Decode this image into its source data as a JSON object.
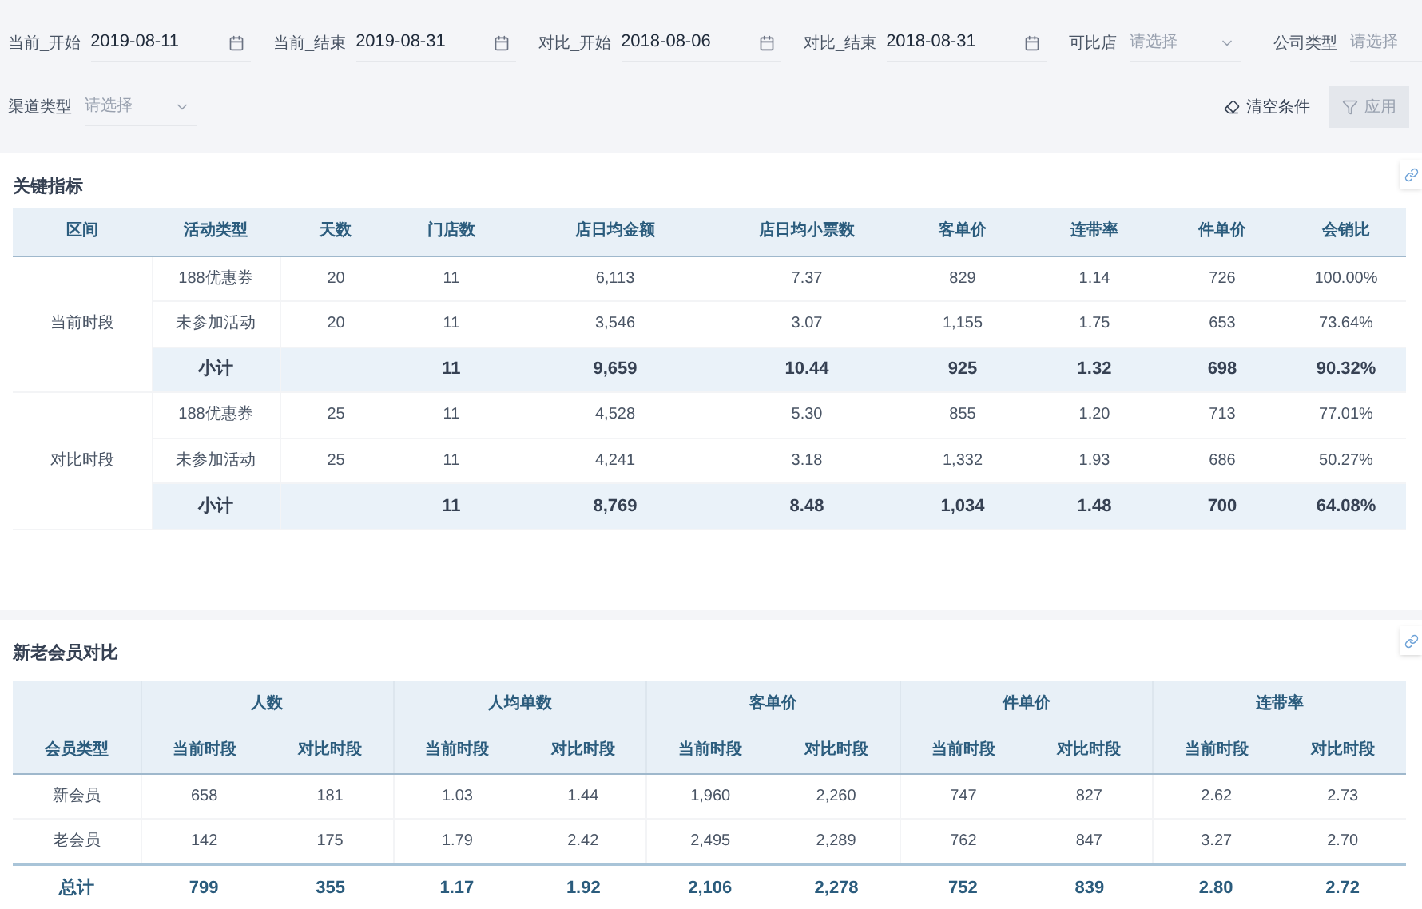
{
  "filters": [
    {
      "kind": "date",
      "label": "当前_开始",
      "value": "2019-08-11"
    },
    {
      "kind": "date",
      "label": "当前_结束",
      "value": "2019-08-31"
    },
    {
      "kind": "date",
      "label": "对比_开始",
      "value": "2018-08-06"
    },
    {
      "kind": "date",
      "label": "对比_结束",
      "value": "2018-08-31"
    },
    {
      "kind": "select",
      "label": "可比店",
      "placeholder": "请选择"
    },
    {
      "kind": "select",
      "label": "公司类型",
      "placeholder": "请选择"
    },
    {
      "kind": "select",
      "label": "渠道类型",
      "placeholder": "请选择"
    }
  ],
  "actions": [
    {
      "kind": "clear",
      "label": "清空条件",
      "disabled": false
    },
    {
      "kind": "apply",
      "label": "应用",
      "disabled": true
    }
  ],
  "key_metrics": {
    "title": "关键指标",
    "columns": [
      "区间",
      "活动类型",
      "天数",
      "门店数",
      "店日均金额",
      "店日均小票数",
      "客单价",
      "连带率",
      "件单价",
      "会销比"
    ],
    "groups": [
      {
        "period": "当前时段",
        "rows": [
          {
            "kind": "detail",
            "cells": [
              "188优惠券",
              "20",
              "11",
              "6,113",
              "7.37",
              "829",
              "1.14",
              "726",
              "100.00%"
            ]
          },
          {
            "kind": "detail",
            "cells": [
              "未参加活动",
              "20",
              "11",
              "3,546",
              "3.07",
              "1,155",
              "1.75",
              "653",
              "73.64%"
            ]
          },
          {
            "kind": "subtotal",
            "cells": [
              "小计",
              null,
              "11",
              "9,659",
              "10.44",
              "925",
              "1.32",
              "698",
              "90.32%"
            ]
          }
        ]
      },
      {
        "period": "对比时段",
        "rows": [
          {
            "kind": "detail",
            "cells": [
              "188优惠券",
              "25",
              "11",
              "4,528",
              "5.30",
              "855",
              "1.20",
              "713",
              "77.01%"
            ]
          },
          {
            "kind": "detail",
            "cells": [
              "未参加活动",
              "25",
              "11",
              "4,241",
              "3.18",
              "1,332",
              "1.93",
              "686",
              "50.27%"
            ]
          },
          {
            "kind": "subtotal",
            "cells": [
              "小计",
              null,
              "11",
              "8,769",
              "8.48",
              "1,034",
              "1.48",
              "700",
              "64.08%"
            ]
          }
        ]
      }
    ]
  },
  "member_compare": {
    "title": "新老会员对比",
    "first_column": "会员类型",
    "groups": [
      {
        "label": "人数",
        "sub": [
          "当前时段",
          "对比时段"
        ]
      },
      {
        "label": "人均单数",
        "sub": [
          "当前时段",
          "对比时段"
        ]
      },
      {
        "label": "客单价",
        "sub": [
          "当前时段",
          "对比时段"
        ]
      },
      {
        "label": "件单价",
        "sub": [
          "当前时段",
          "对比时段"
        ]
      },
      {
        "label": "连带率",
        "sub": [
          "当前时段",
          "对比时段"
        ]
      }
    ],
    "rows": [
      {
        "kind": "detail",
        "cells": [
          "新会员",
          "658",
          "181",
          "1.03",
          "1.44",
          "1,960",
          "2,260",
          "747",
          "827",
          "2.62",
          "2.73"
        ]
      },
      {
        "kind": "detail",
        "cells": [
          "老会员",
          "142",
          "175",
          "1.79",
          "2.42",
          "2,495",
          "2,289",
          "762",
          "847",
          "3.27",
          "2.70"
        ]
      },
      {
        "kind": "total",
        "cells": [
          "总计",
          "799",
          "355",
          "1.17",
          "1.92",
          "2,106",
          "2,278",
          "752",
          "839",
          "2.80",
          "2.72"
        ]
      }
    ]
  }
}
